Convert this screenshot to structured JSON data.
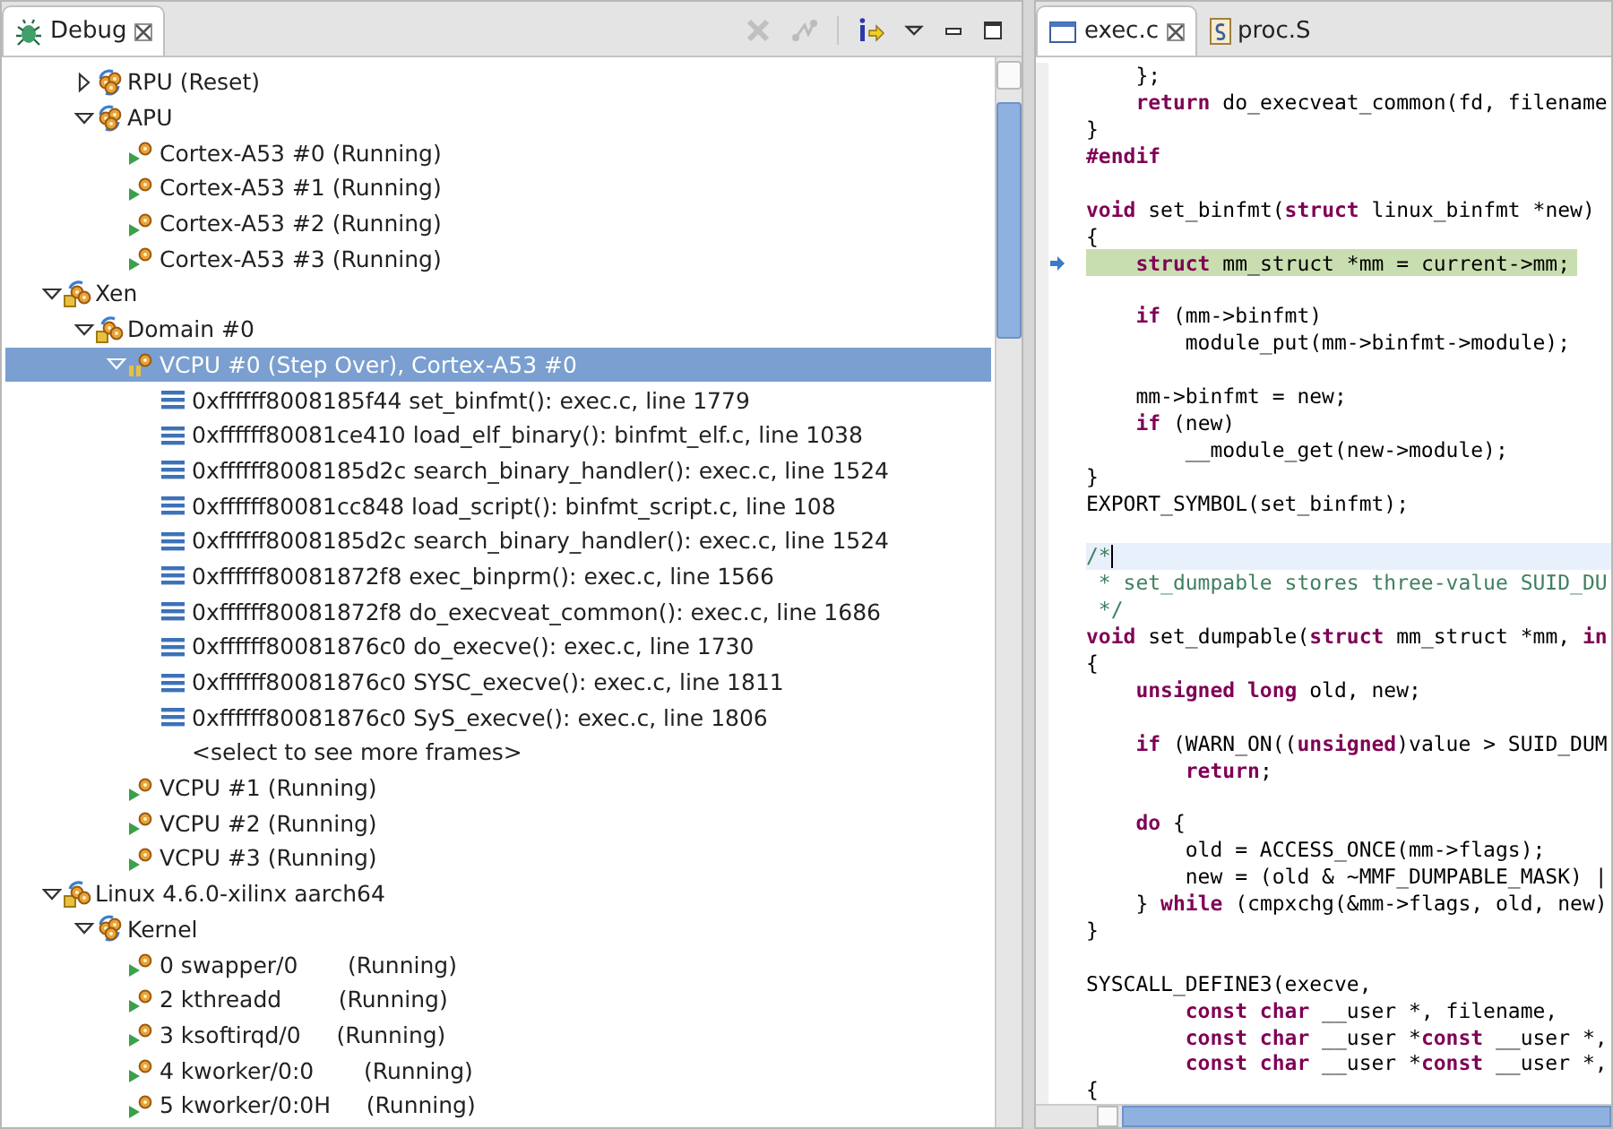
{
  "debug_view": {
    "tab": {
      "title": "Debug",
      "selected": true
    },
    "tree": [
      {
        "children": [
          {
            "label": "RPU (Reset)",
            "kind": "target",
            "expanded": false,
            "selected": false
          },
          {
            "label": "APU",
            "kind": "target",
            "expanded": true,
            "selected": false,
            "children": [
              {
                "label": "Cortex-A53 #0 (Running)",
                "kind": "thread",
                "selected": false
              },
              {
                "label": "Cortex-A53 #1 (Running)",
                "kind": "thread",
                "selected": false
              },
              {
                "label": "Cortex-A53 #2 (Running)",
                "kind": "thread",
                "selected": false
              },
              {
                "label": "Cortex-A53 #3 (Running)",
                "kind": "thread",
                "selected": false
              }
            ]
          }
        ]
      },
      {
        "label": "Xen",
        "kind": "system",
        "expanded": true,
        "selected": false,
        "children": [
          {
            "label": "Domain #0",
            "kind": "system",
            "expanded": true,
            "selected": false,
            "children": [
              {
                "label": "VCPU #0 (Step Over), Cortex-A53 #0",
                "kind": "suspended",
                "expanded": true,
                "selected": true,
                "children": [
                  {
                    "label": "0xffffff8008185f44 set_binfmt(): exec.c, line 1779",
                    "kind": "frame",
                    "selected": false
                  },
                  {
                    "label": "0xffffff80081ce410 load_elf_binary(): binfmt_elf.c, line 1038",
                    "kind": "frame",
                    "selected": false
                  },
                  {
                    "label": "0xffffff8008185d2c search_binary_handler(): exec.c, line 1524",
                    "kind": "frame",
                    "selected": false
                  },
                  {
                    "label": "0xffffff80081cc848 load_script(): binfmt_script.c, line 108",
                    "kind": "frame",
                    "selected": false
                  },
                  {
                    "label": "0xffffff8008185d2c search_binary_handler(): exec.c, line 1524",
                    "kind": "frame",
                    "selected": false
                  },
                  {
                    "label": "0xffffff80081872f8 exec_binprm(): exec.c, line 1566",
                    "kind": "frame",
                    "selected": false
                  },
                  {
                    "label": "0xffffff80081872f8 do_execveat_common(): exec.c, line 1686",
                    "kind": "frame",
                    "selected": false
                  },
                  {
                    "label": "0xffffff80081876c0 do_execve(): exec.c, line 1730",
                    "kind": "frame",
                    "selected": false
                  },
                  {
                    "label": "0xffffff80081876c0 SYSC_execve(): exec.c, line 1811",
                    "kind": "frame",
                    "selected": false
                  },
                  {
                    "label": "0xffffff80081876c0 SyS_execve(): exec.c, line 1806",
                    "kind": "frame",
                    "selected": false
                  },
                  {
                    "label": "<select to see more frames>",
                    "kind": "more",
                    "selected": false
                  }
                ]
              },
              {
                "label": "VCPU #1 (Running)",
                "kind": "thread",
                "selected": false
              },
              {
                "label": "VCPU #2 (Running)",
                "kind": "thread",
                "selected": false
              },
              {
                "label": "VCPU #3 (Running)",
                "kind": "thread",
                "selected": false
              }
            ]
          }
        ]
      },
      {
        "label": "Linux 4.6.0-xilinx aarch64",
        "kind": "system",
        "expanded": true,
        "selected": false,
        "children": [
          {
            "label": "Kernel",
            "kind": "target",
            "expanded": true,
            "selected": false,
            "children": [
              {
                "label": "0 swapper/0       (Running)",
                "kind": "thread",
                "selected": false
              },
              {
                "label": "2 kthreadd        (Running)",
                "kind": "thread",
                "selected": false
              },
              {
                "label": "3 ksoftirqd/0     (Running)",
                "kind": "thread",
                "selected": false
              },
              {
                "label": "4 kworker/0:0       (Running)",
                "kind": "thread",
                "selected": false
              },
              {
                "label": "5 kworker/0:0H     (Running)",
                "kind": "thread",
                "selected": false
              }
            ]
          }
        ]
      }
    ]
  },
  "editor": {
    "tabs": [
      {
        "title": "exec.c",
        "kind": "c",
        "selected": true
      },
      {
        "title": "proc.S",
        "kind": "asm",
        "selected": false
      }
    ],
    "lines": [
      {
        "kind": "code",
        "tokens": [
          {
            "kind": "plain",
            "text": "    };"
          }
        ]
      },
      {
        "kind": "code",
        "tokens": [
          {
            "kind": "keyword",
            "text": "    return"
          },
          {
            "kind": "plain",
            "text": " do_execveat_common(fd, filename"
          }
        ]
      },
      {
        "kind": "code",
        "tokens": [
          {
            "kind": "plain",
            "text": "}"
          }
        ]
      },
      {
        "kind": "code",
        "tokens": [
          {
            "kind": "keyword",
            "text": "#endif"
          }
        ]
      },
      {
        "kind": "code"
      },
      {
        "kind": "code",
        "tokens": [
          {
            "kind": "keyword",
            "text": "void"
          },
          {
            "kind": "plain",
            "text": " set_binfmt("
          },
          {
            "kind": "keyword",
            "text": "struct"
          },
          {
            "kind": "plain",
            "text": " linux_binfmt *new)"
          }
        ]
      },
      {
        "kind": "code",
        "tokens": [
          {
            "kind": "plain",
            "text": "{"
          }
        ]
      },
      {
        "kind": "current",
        "tokens": [
          {
            "kind": "keyword",
            "text": "    struct"
          },
          {
            "kind": "plain",
            "text": " mm_struct *mm = current->mm;"
          }
        ]
      },
      {
        "kind": "code"
      },
      {
        "kind": "code",
        "tokens": [
          {
            "kind": "keyword",
            "text": "    if"
          },
          {
            "kind": "plain",
            "text": " (mm->binfmt)"
          }
        ]
      },
      {
        "kind": "code",
        "tokens": [
          {
            "kind": "plain",
            "text": "        module_put(mm->binfmt->module);"
          }
        ]
      },
      {
        "kind": "code"
      },
      {
        "kind": "code",
        "tokens": [
          {
            "kind": "plain",
            "text": "    mm->binfmt = new;"
          }
        ]
      },
      {
        "kind": "code",
        "tokens": [
          {
            "kind": "keyword",
            "text": "    if"
          },
          {
            "kind": "plain",
            "text": " (new)"
          }
        ]
      },
      {
        "kind": "code",
        "tokens": [
          {
            "kind": "plain",
            "text": "        __module_get(new->module);"
          }
        ]
      },
      {
        "kind": "code",
        "tokens": [
          {
            "kind": "plain",
            "text": "}"
          }
        ]
      },
      {
        "kind": "code",
        "tokens": [
          {
            "kind": "plain",
            "text": "EXPORT_SYMBOL(set_binfmt);"
          }
        ]
      },
      {
        "kind": "code"
      },
      {
        "kind": "cursor",
        "tokens": [
          {
            "kind": "comment",
            "text": "/*"
          }
        ]
      },
      {
        "kind": "code",
        "tokens": [
          {
            "kind": "comment",
            "text": " * set_dumpable stores three-value SUID_DU"
          }
        ]
      },
      {
        "kind": "code",
        "tokens": [
          {
            "kind": "comment",
            "text": " */"
          }
        ]
      },
      {
        "kind": "code",
        "tokens": [
          {
            "kind": "keyword",
            "text": "void"
          },
          {
            "kind": "plain",
            "text": " set_dumpable("
          },
          {
            "kind": "keyword",
            "text": "struct"
          },
          {
            "kind": "plain",
            "text": " mm_struct *mm, "
          },
          {
            "kind": "keyword",
            "text": "in"
          }
        ]
      },
      {
        "kind": "code",
        "tokens": [
          {
            "kind": "plain",
            "text": "{"
          }
        ]
      },
      {
        "kind": "code",
        "tokens": [
          {
            "kind": "keyword",
            "text": "    unsigned long"
          },
          {
            "kind": "plain",
            "text": " old, new;"
          }
        ]
      },
      {
        "kind": "code"
      },
      {
        "kind": "code",
        "tokens": [
          {
            "kind": "keyword",
            "text": "    if"
          },
          {
            "kind": "plain",
            "text": " (WARN_ON(("
          },
          {
            "kind": "keyword",
            "text": "unsigned"
          },
          {
            "kind": "plain",
            "text": ")value > SUID_DUM"
          }
        ]
      },
      {
        "kind": "code",
        "tokens": [
          {
            "kind": "keyword",
            "text": "        return"
          },
          {
            "kind": "plain",
            "text": ";"
          }
        ]
      },
      {
        "kind": "code"
      },
      {
        "kind": "code",
        "tokens": [
          {
            "kind": "keyword",
            "text": "    do"
          },
          {
            "kind": "plain",
            "text": " {"
          }
        ]
      },
      {
        "kind": "code",
        "tokens": [
          {
            "kind": "plain",
            "text": "        old = ACCESS_ONCE(mm->flags);"
          }
        ]
      },
      {
        "kind": "code",
        "tokens": [
          {
            "kind": "plain",
            "text": "        new = (old & ~MMF_DUMPABLE_MASK) |"
          }
        ]
      },
      {
        "kind": "code",
        "tokens": [
          {
            "kind": "plain",
            "text": "    } "
          },
          {
            "kind": "keyword",
            "text": "while"
          },
          {
            "kind": "plain",
            "text": " (cmpxchg(&mm->flags, old, new)"
          }
        ]
      },
      {
        "kind": "code",
        "tokens": [
          {
            "kind": "plain",
            "text": "}"
          }
        ]
      },
      {
        "kind": "code"
      },
      {
        "kind": "code",
        "tokens": [
          {
            "kind": "plain",
            "text": "SYSCALL_DEFINE3(execve,"
          }
        ]
      },
      {
        "kind": "code",
        "tokens": [
          {
            "kind": "keyword",
            "text": "        const char"
          },
          {
            "kind": "plain",
            "text": " __user *, filename,"
          }
        ]
      },
      {
        "kind": "code",
        "tokens": [
          {
            "kind": "keyword",
            "text": "        const char"
          },
          {
            "kind": "plain",
            "text": " __user *"
          },
          {
            "kind": "keyword",
            "text": "const"
          },
          {
            "kind": "plain",
            "text": " __user *,"
          }
        ]
      },
      {
        "kind": "code",
        "tokens": [
          {
            "kind": "keyword",
            "text": "        const char"
          },
          {
            "kind": "plain",
            "text": " __user *"
          },
          {
            "kind": "keyword",
            "text": "const"
          },
          {
            "kind": "plain",
            "text": " __user *,"
          }
        ]
      },
      {
        "kind": "code",
        "tokens": [
          {
            "kind": "plain",
            "text": "{"
          }
        ]
      }
    ]
  }
}
